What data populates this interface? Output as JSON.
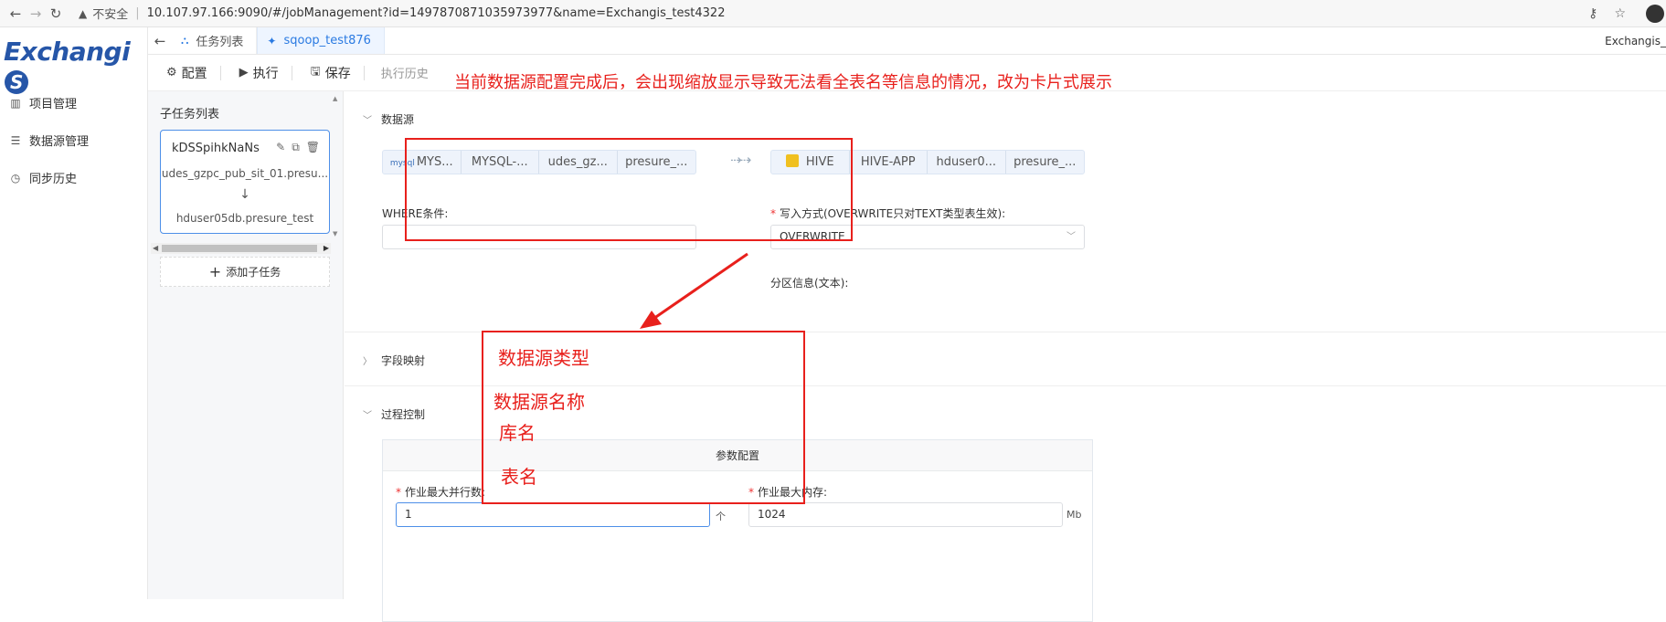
{
  "browser": {
    "security_label": "不安全",
    "url": "10.107.97.166:9090/#/jobManagement?id=1497870871035973977&name=Exchangis_test4322"
  },
  "app": {
    "logo": "Exchangi",
    "logo_s": "S",
    "user": "Exchangis_"
  },
  "sidebar": {
    "items": [
      {
        "label": "项目管理",
        "icon": "project-icon"
      },
      {
        "label": "数据源管理",
        "icon": "datasource-icon"
      },
      {
        "label": "同步历史",
        "icon": "history-icon"
      }
    ]
  },
  "tabs": [
    {
      "label": "任务列表",
      "icon": "sitemap-icon",
      "active": false
    },
    {
      "label": "sqoop_test876",
      "icon": "sqoop-icon",
      "active": true
    }
  ],
  "toolbar": {
    "config": "配置",
    "run": "执行",
    "save": "保存",
    "hidden": "执行历史"
  },
  "subtasks": {
    "title": "子任务列表",
    "card": {
      "name": "kDSSpihkNaNs",
      "source": "udes_gzpc_pub_sit_01.presu...",
      "arrow": "↓",
      "target": "hduser05db.presure_test"
    },
    "add_label": "添加子任务"
  },
  "main": {
    "section_datasource": "数据源",
    "source_segments": [
      "MYS...",
      "MYSQL-...",
      "udes_gz...",
      "presure_..."
    ],
    "source_logo": "mysql",
    "target_segments": [
      "HIVE",
      "HIVE-APP",
      "hduser0...",
      "presure_..."
    ],
    "where_label": "WHERE条件:",
    "where_value": "",
    "write_mode_label": "写入方式(OVERWRITE只对TEXT类型表生效):",
    "write_mode_value": "OVERWRITE",
    "partition_label": "分区信息(文本):",
    "section_field_mapping": "字段映射",
    "section_process": "过程控制",
    "param_title": "参数配置",
    "max_parallel_label": "作业最大并行数:",
    "max_parallel_value": "1",
    "max_parallel_unit": "个",
    "max_memory_label": "作业最大内存:",
    "max_memory_value": "1024",
    "max_memory_unit": "Mb"
  },
  "annotations": {
    "top_note": "当前数据源配置完成后，会出现缩放显示导致无法看全表名等信息的情况，改为卡片式展示",
    "card_lines": [
      "数据源类型",
      "数据源名称",
      "库名",
      "表名"
    ],
    "color": "#e8201c"
  }
}
